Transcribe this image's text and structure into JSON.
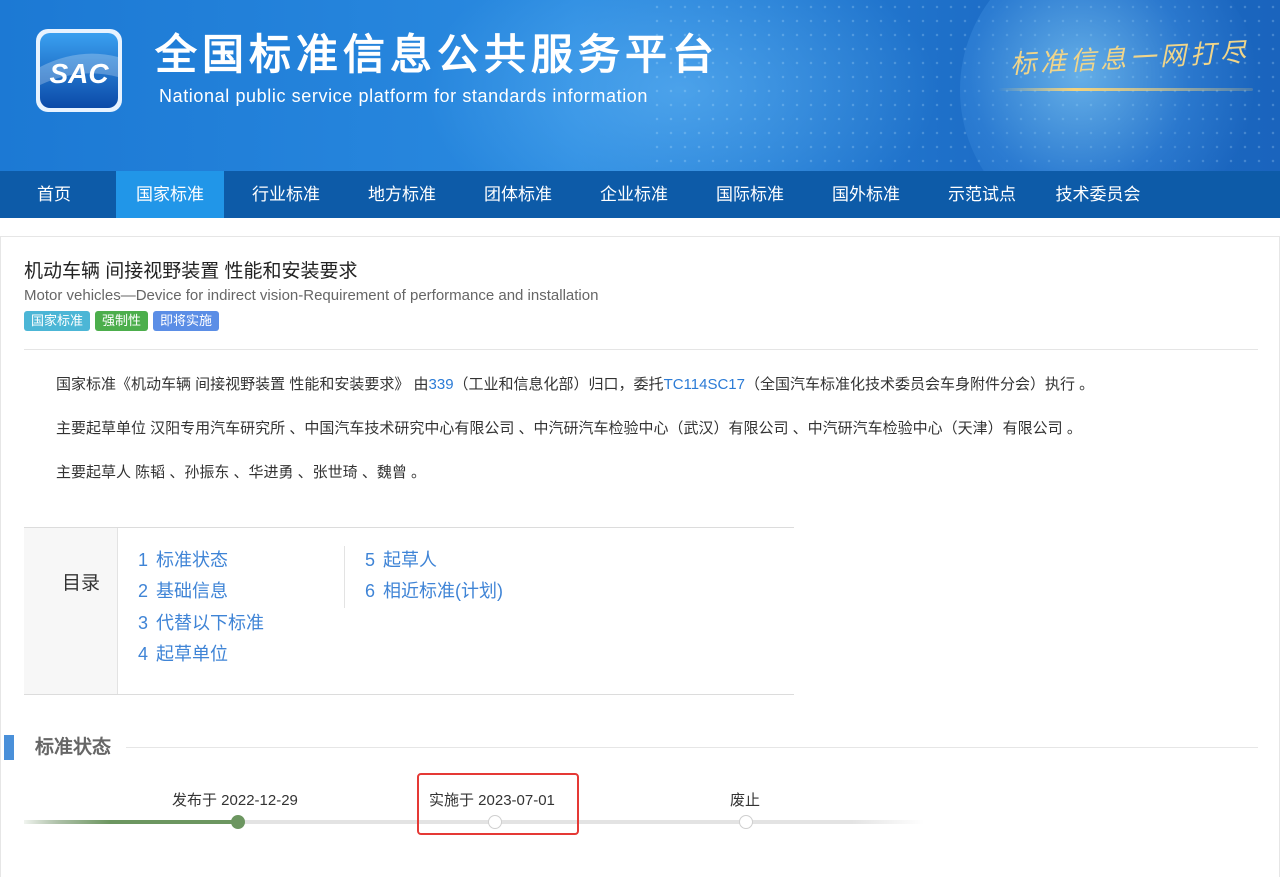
{
  "header": {
    "logo_text": "SAC",
    "title": "全国标准信息公共服务平台",
    "subtitle": "National public service platform  for standards information",
    "slogan": "标准信息一网打尽"
  },
  "nav": {
    "items": [
      {
        "label": "首页"
      },
      {
        "label": "国家标准"
      },
      {
        "label": "行业标准"
      },
      {
        "label": "地方标准"
      },
      {
        "label": "团体标准"
      },
      {
        "label": "企业标准"
      },
      {
        "label": "国际标准"
      },
      {
        "label": "国外标准"
      },
      {
        "label": "示范试点"
      },
      {
        "label": "技术委员会"
      }
    ],
    "active": "国家标准"
  },
  "standard": {
    "title": "机动车辆 间接视野装置 性能和安装要求",
    "title_en": "Motor vehicles—Device for indirect vision-Requirement of performance and installation",
    "tags": [
      "国家标准",
      "强制性",
      "即将实施"
    ],
    "para1": {
      "prefix": "国家标准《机动车辆 间接视野装置 性能和安装要求》 由",
      "dept_code": "339",
      "mid": "（工业和信息化部）归口，委托",
      "tc_code": "TC114SC17",
      "suffix": "（全国汽车标准化技术委员会车身附件分会）执行 。"
    },
    "para2": "主要起草单位 汉阳专用汽车研究所 、中国汽车技术研究中心有限公司 、中汽研汽车检验中心（武汉）有限公司 、中汽研汽车检验中心（天津）有限公司 。",
    "para3": "主要起草人 陈韬 、孙振东 、华进勇 、张世琦 、魏曾 。"
  },
  "toc": {
    "label": "目录",
    "items": [
      {
        "num": "1",
        "label": "标准状态"
      },
      {
        "num": "2",
        "label": "基础信息"
      },
      {
        "num": "3",
        "label": "代替以下标准"
      },
      {
        "num": "4",
        "label": "起草单位"
      },
      {
        "num": "5",
        "label": "起草人"
      },
      {
        "num": "6",
        "label": "相近标准(计划)"
      }
    ]
  },
  "status_section": {
    "title": "标准状态",
    "timeline": [
      {
        "label": "发布于 2022-12-29",
        "done": true
      },
      {
        "label": "实施于 2023-07-01",
        "done": false
      },
      {
        "label": "废止",
        "done": false
      }
    ],
    "progress_fraction": 0.24
  },
  "colors": {
    "nav_bg": "#0d5ba8",
    "nav_active": "#2196e8",
    "link": "#3f84d6",
    "timeline_done": "#6c9660",
    "highlight": "#e53935"
  }
}
